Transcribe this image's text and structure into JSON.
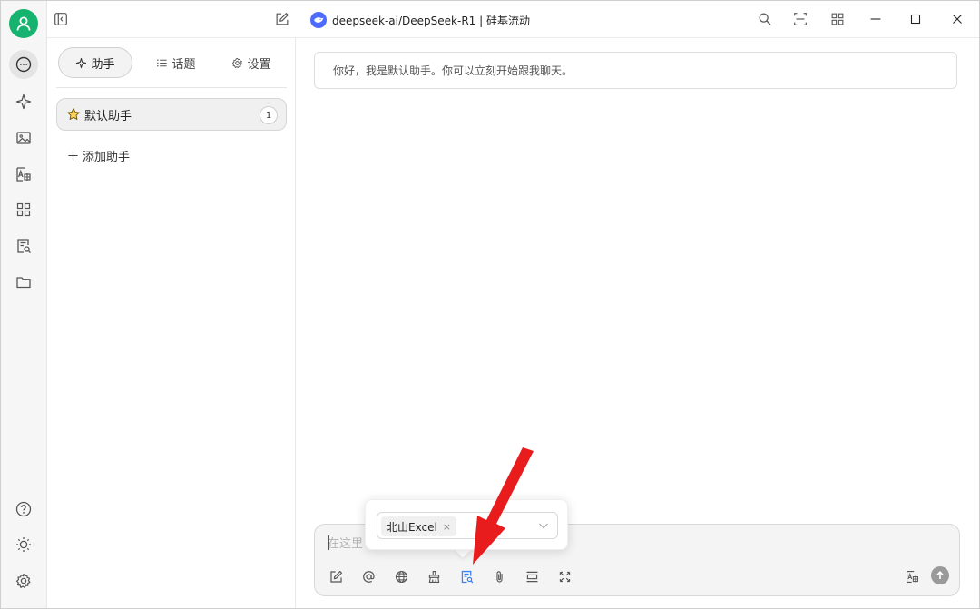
{
  "window": {
    "model_label": "deepseek-ai/DeepSeek-R1 | 硅基流动"
  },
  "colors": {
    "avatar_green": "#16b36e",
    "model_blue": "#4d6bfe",
    "active_tool_blue": "#3b82f6",
    "annotation_red": "#e81c1c"
  },
  "rail": {
    "items": [
      {
        "icon": "chat-bubble-icon",
        "active": true
      },
      {
        "icon": "sparkle-icon"
      },
      {
        "icon": "image-icon"
      },
      {
        "icon": "translate-icon"
      },
      {
        "icon": "apps-grid-icon"
      },
      {
        "icon": "knowledge-base-icon"
      },
      {
        "icon": "folder-icon"
      }
    ],
    "bottom": [
      {
        "icon": "help-icon"
      },
      {
        "icon": "theme-sun-icon"
      },
      {
        "icon": "settings-gear-icon"
      }
    ]
  },
  "panel": {
    "tabs": [
      {
        "label": "助手",
        "active": true
      },
      {
        "label": "话题"
      },
      {
        "label": "设置"
      }
    ],
    "assistant": {
      "name": "默认助手",
      "count": "1"
    },
    "add_label": "添加助手"
  },
  "chat": {
    "welcome": "你好，我是默认助手。你可以立刻开始跟我聊天。"
  },
  "composer": {
    "placeholder": "在这里",
    "tools": [
      "new-topic-icon",
      "mention-icon",
      "web-search-icon",
      "clear-icon",
      "knowledge-base-icon",
      "attachment-icon",
      "context-icon",
      "expand-icon"
    ]
  },
  "knowledge_popover": {
    "selected_tag": "北山Excel",
    "close_glyph": "×"
  }
}
